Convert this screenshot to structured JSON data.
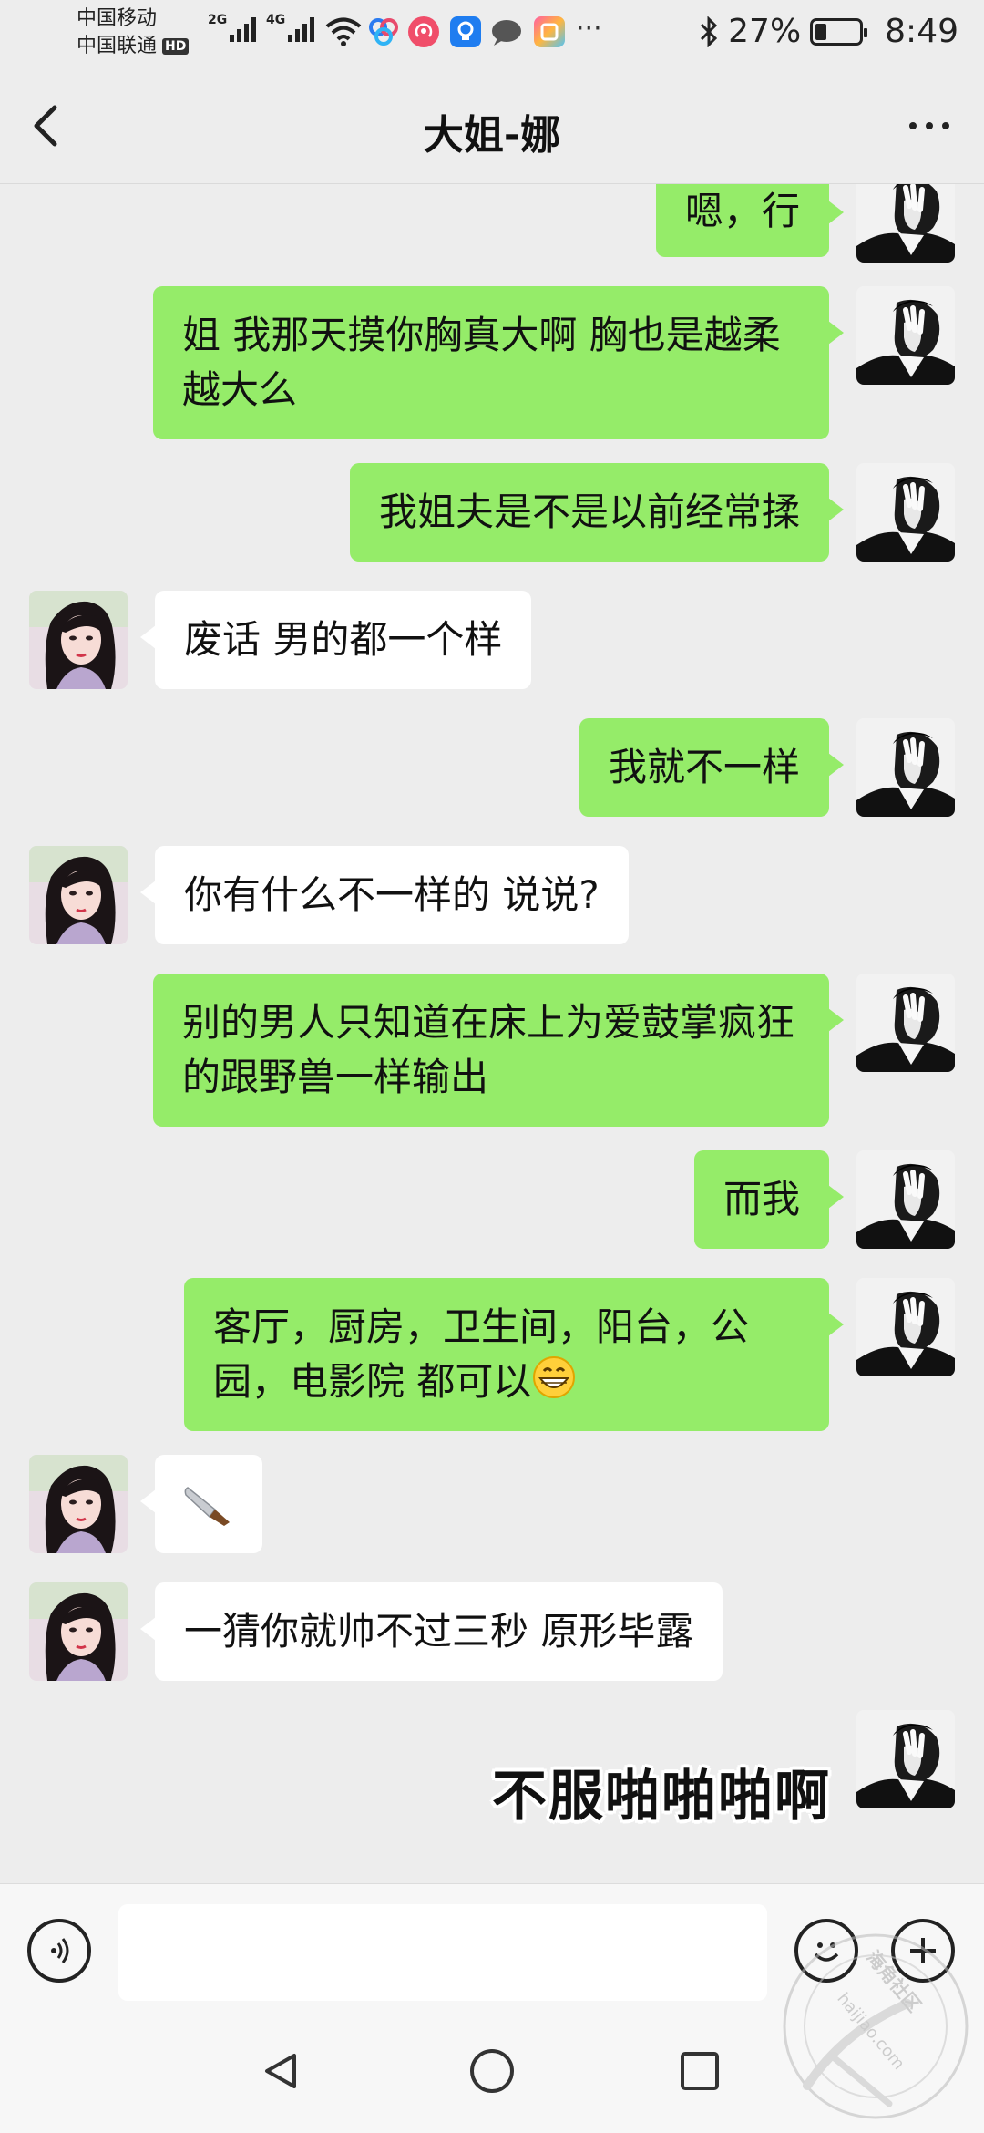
{
  "status_bar": {
    "carrier_1": "中国移动",
    "carrier_2": "中国联通",
    "hd_badge": "HD",
    "network_1": "2G",
    "network_2": "4G",
    "more_dots": "···",
    "battery_percent": "27%",
    "battery_level": 0.27,
    "time": "8:49"
  },
  "header": {
    "title": "大姐-娜"
  },
  "messages": [
    {
      "from": "me",
      "text": "嗯，行"
    },
    {
      "from": "me",
      "text": "姐 我那天摸你胸真大啊  胸也是越柔越大么"
    },
    {
      "from": "me",
      "text": "我姐夫是不是以前经常揉"
    },
    {
      "from": "other",
      "text": "废话 男的都一个样"
    },
    {
      "from": "me",
      "text": "我就不一样"
    },
    {
      "from": "other",
      "text": "你有什么不一样的 说说?"
    },
    {
      "from": "me",
      "text": "别的男人只知道在床上为爱鼓掌疯狂的跟野兽一样输出"
    },
    {
      "from": "me",
      "text": "而我"
    },
    {
      "from": "me",
      "text": "客厅，厨房，卫生间，阳台，公园，电影院 都可以",
      "emoji": "grinning-face"
    },
    {
      "from": "other",
      "text": "",
      "emoji": "kitchen-knife"
    },
    {
      "from": "other",
      "text": "一猜你就帅不过三秒  原形毕露"
    },
    {
      "from": "me",
      "sticker_text": "不服啪啪啪啊"
    }
  ],
  "input": {
    "placeholder": "",
    "value": ""
  },
  "watermark": {
    "site": "haijiao.com",
    "name": "海角社区"
  },
  "colors": {
    "my_bubble": "#95ec69",
    "other_bubble": "#ffffff",
    "chat_background": "#ededed"
  }
}
